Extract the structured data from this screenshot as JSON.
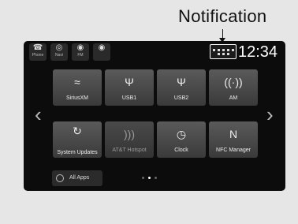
{
  "annotation": {
    "label": "Notification"
  },
  "top_bar": {
    "buttons": [
      {
        "id": "phone",
        "label": "Phone",
        "icon": "phone-icon",
        "glyph": "☎"
      },
      {
        "id": "navi",
        "label": "Navi",
        "icon": "navi-icon",
        "glyph": "◎"
      },
      {
        "id": "fm",
        "label": "FM",
        "icon": "radio-icon",
        "glyph": "◉"
      },
      {
        "id": "audio",
        "label": "",
        "icon": "audio-source-icon",
        "glyph": "◉"
      }
    ],
    "clock": "12:34"
  },
  "apps": [
    {
      "label": "SiriusXM",
      "icon": "siriusxm-icon",
      "glyph": "≈",
      "enabled": true
    },
    {
      "label": "USB1",
      "icon": "usb-icon",
      "glyph": "Ψ",
      "enabled": true
    },
    {
      "label": "USB2",
      "icon": "usb-icon",
      "glyph": "Ψ",
      "enabled": true
    },
    {
      "label": "AM",
      "icon": "am-radio-icon",
      "glyph": "((·))",
      "enabled": true
    },
    {
      "label": "System Updates",
      "icon": "refresh-icon",
      "glyph": "↻",
      "enabled": true
    },
    {
      "label": "AT&T Hotspot",
      "icon": "wifi-hotspot-icon",
      "glyph": ")))",
      "enabled": false
    },
    {
      "label": "Clock",
      "icon": "clock-icon",
      "glyph": "◷",
      "enabled": true
    },
    {
      "label": "NFC Manager",
      "icon": "nfc-icon",
      "glyph": "N",
      "enabled": true
    }
  ],
  "navigation": {
    "prev": "‹",
    "next": "›"
  },
  "all_apps": {
    "label": "All Apps"
  },
  "pager": {
    "current_page": 2,
    "total_pages": 3
  }
}
